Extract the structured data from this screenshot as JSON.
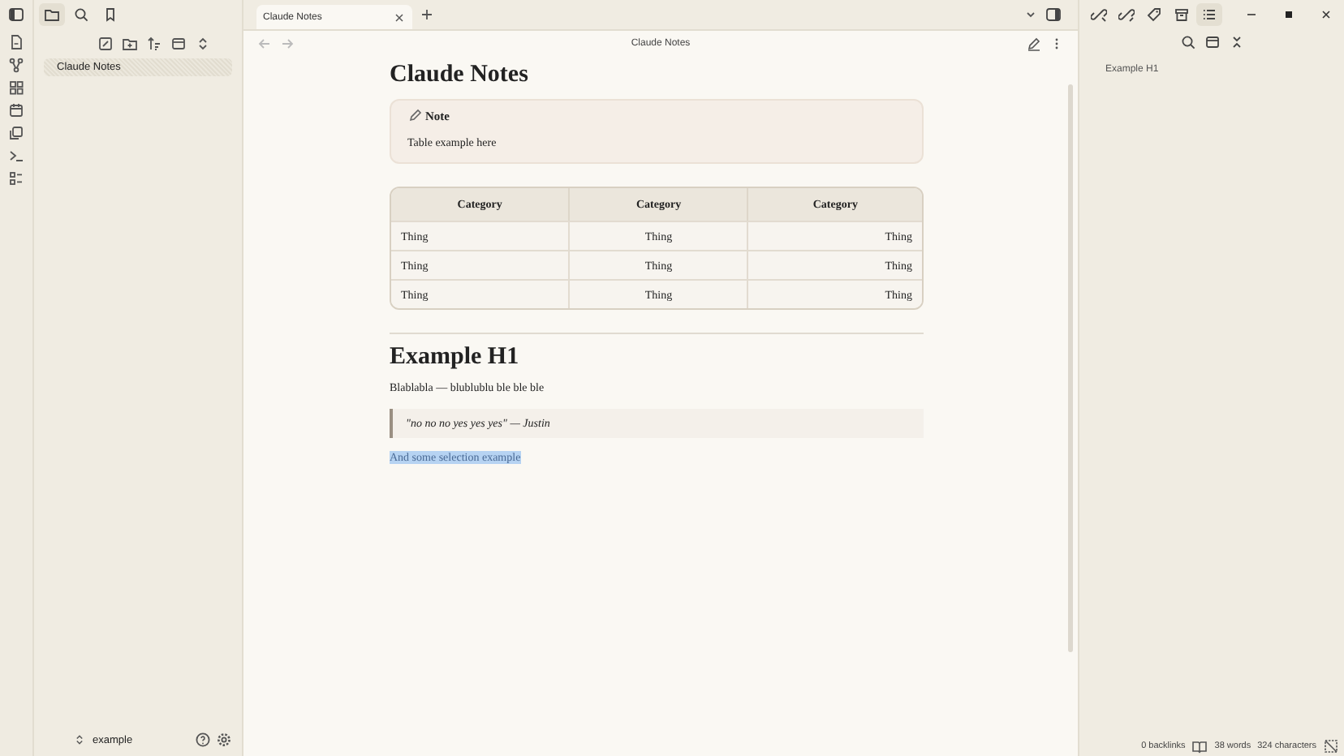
{
  "left_panel_tabs": [
    {
      "selected": true
    },
    {
      "selected": false
    },
    {
      "selected": false
    }
  ],
  "file_tree": {
    "items": [
      {
        "label": "Claude Notes",
        "selected": true
      }
    ],
    "vault": "example"
  },
  "tabs": [
    {
      "label": "Claude Notes",
      "selected": true
    }
  ],
  "view_title": "Claude Notes",
  "note": {
    "title": "Claude Notes",
    "callout": {
      "title": "Note",
      "body": "Table example here"
    },
    "table": {
      "columns": [
        "Category",
        "Category",
        "Category"
      ],
      "rows": [
        [
          "Thing",
          "Thing",
          "Thing"
        ],
        [
          "Thing",
          "Thing",
          "Thing"
        ],
        [
          "Thing",
          "Thing",
          "Thing"
        ]
      ]
    },
    "heading": "Example H1",
    "paragraph": "Blablabla — blublublu ble ble ble",
    "quote": "\"no no no yes yes yes\" — Justin",
    "selected_text": "And some selection example"
  },
  "right_panel_tabs": [
    {
      "selected": false
    },
    {
      "selected": false
    },
    {
      "selected": false
    },
    {
      "selected": false
    },
    {
      "selected": true
    }
  ],
  "outline": {
    "items": [
      "Example H1"
    ]
  },
  "status_bar": {
    "backlinks": "0 backlinks",
    "words": "38 words",
    "characters": "324 characters"
  }
}
